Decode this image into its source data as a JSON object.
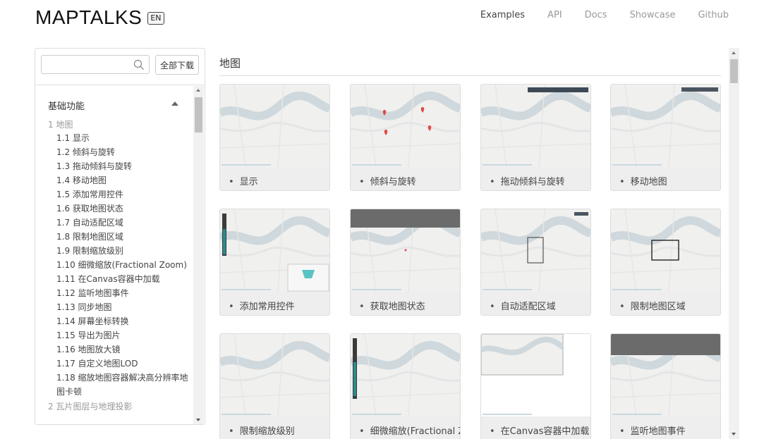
{
  "header": {
    "logo": "MAPTALKS",
    "lang": "EN",
    "nav": [
      "Examples",
      "API",
      "Docs",
      "Showcase",
      "Github"
    ],
    "active_nav": "Examples"
  },
  "sidebar": {
    "search_placeholder": "",
    "download_label": "全部下载",
    "section_title": "基础功能",
    "category": "1 地图",
    "items": [
      "1.1 显示",
      "1.2 倾斜与旋转",
      "1.3 拖动倾斜与旋转",
      "1.4 移动地图",
      "1.5 添加常用控件",
      "1.6 获取地图状态",
      "1.7 自动适配区域",
      "1.8 限制地图区域",
      "1.9 限制缩放级别",
      "1.10 细微缩放(Fractional Zoom)",
      "1.11 在Canvas容器中加载",
      "1.12 监听地图事件",
      "1.13 同步地图",
      "1.14 屏幕坐标转换",
      "1.15 导出为图片",
      "1.16 地图放大镜",
      "1.17 自定义地图LOD",
      "1.18 缩放地图容器解决高分辨率地图卡顿"
    ],
    "next_category": "2 瓦片图层与地理投影"
  },
  "main": {
    "title": "地图",
    "cards": [
      {
        "label": "显示",
        "variant": "plain"
      },
      {
        "label": "倾斜与旋转",
        "variant": "markers"
      },
      {
        "label": "拖动倾斜与旋转",
        "variant": "toolbar"
      },
      {
        "label": "移动地图",
        "variant": "controls"
      },
      {
        "label": "添加常用控件",
        "variant": "zoombar"
      },
      {
        "label": "获取地图状态",
        "variant": "status"
      },
      {
        "label": "自动适配区域",
        "variant": "fitbox"
      },
      {
        "label": "限制地图区域",
        "variant": "extent"
      },
      {
        "label": "限制缩放级别",
        "variant": "plain"
      },
      {
        "label": "细微缩放(Fractional Zoom)",
        "variant": "zoomslider"
      },
      {
        "label": "在Canvas容器中加载",
        "variant": "canvas"
      },
      {
        "label": "监听地图事件",
        "variant": "events"
      }
    ]
  },
  "colors": {
    "map_water": "#cfd8dc",
    "map_land": "#f0f0ef",
    "marker": "#e04848",
    "accent_teal": "#2a8c8c"
  }
}
